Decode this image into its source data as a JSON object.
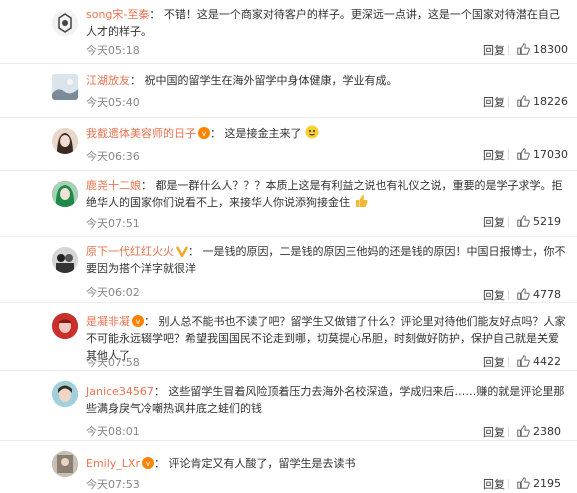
{
  "reply_label": "回复",
  "comments": [
    {
      "user": "song宋-至秦",
      "sep": "：",
      "text": "不错！这是一个商家对待客户的样子。更深远一点讲，这是一个国家对待潜在自己人才的样子。",
      "time": "今天05:18",
      "likes": "18300"
    },
    {
      "user": "江湖放友",
      "sep": "：",
      "text": "祝中国的留学生在海外留学中身体健康，学业有成。",
      "time": "今天05:40",
      "likes": "18226"
    },
    {
      "user": "我截遗体美容师的日子",
      "sep": "：",
      "text": "这是接金主来了",
      "time": "今天06:36",
      "likes": "17030"
    },
    {
      "user": "鹿尧十二娘",
      "sep": "：",
      "text": "都是一群什么人？？？本质上这是有利益之说也有礼仪之说，重要的是学子求学。拒绝华人的国家你们说看不上，来接华人你说添狗接金住",
      "time": "今天07:51",
      "likes": "5219"
    },
    {
      "user": "原下一代红红火火",
      "sep": "：",
      "text": "一是钱的原因，二是钱的原因三他妈的还是钱的原因！中国日报博士，你不要因为搭个洋字就很洋",
      "time": "今天06:02",
      "likes": "4778"
    },
    {
      "user": "是凝非凝",
      "sep": "：",
      "text": "别人总不能书也不读了吧？留学生又做错了什么？评论里对待他们能友好点吗？人家不可能永远辍学吧？希望我国国民不论走到哪，切莫提心吊胆，时刻做好防护，保护自己就是关爱其他人了",
      "time": "今天07:58",
      "likes": "4422"
    },
    {
      "user": "Janice34567",
      "sep": "：",
      "text": "这些留学生冒着风险顶着压力去海外名校深造，学成归来后……赚的就是评论里那些满身戾气冷嘲热讽井底之蛙们的钱",
      "time": "今天08:01",
      "likes": "2380"
    },
    {
      "user": "Emily_LXr",
      "sep": "：",
      "text": "评论肯定又有人酸了，留学生是去读书",
      "time": "今天07:53",
      "likes": "2195"
    }
  ]
}
